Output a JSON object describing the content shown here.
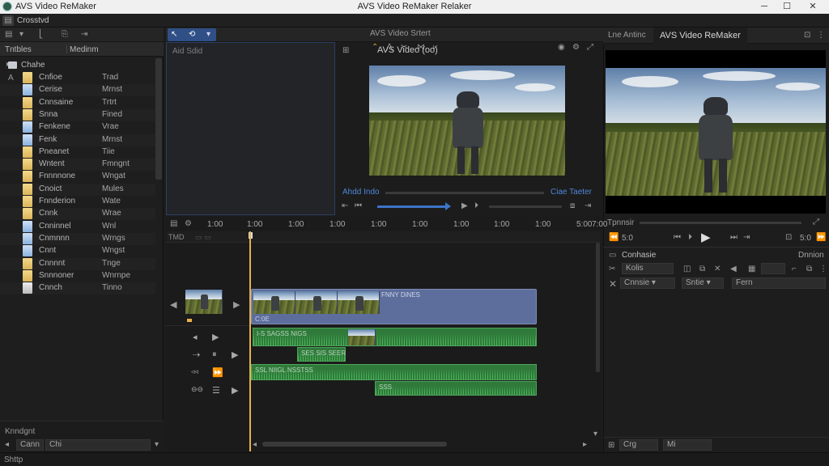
{
  "titlebar": {
    "app_name": "AVS Video ReMaker",
    "window_title": "AVS Video ReMaker Relaker",
    "minimize": "─",
    "maximize": "☐",
    "close": "✕"
  },
  "menu": {
    "project_name": "Crosstvd"
  },
  "mid_toolbar": {
    "title": "AVS Video Srtert"
  },
  "left_panel": {
    "header_left": "Tntbles",
    "header_right": "Medinm",
    "group_name": "Chahe",
    "files": [
      {
        "name": "Cnfioe",
        "type": "Trad",
        "icon": "folder"
      },
      {
        "name": "Cerise",
        "type": "Mrnst",
        "icon": "document"
      },
      {
        "name": "Cnnsaine",
        "type": "Trtrt",
        "icon": "folder"
      },
      {
        "name": "Snna",
        "type": "Fined",
        "icon": "folder"
      },
      {
        "name": "Fenkene",
        "type": "Vrae",
        "icon": "document"
      },
      {
        "name": "Fenk",
        "type": "Mrnst",
        "icon": "document"
      },
      {
        "name": "Pneanet",
        "type": "Tiie",
        "icon": "folder"
      },
      {
        "name": "Wntent",
        "type": "Fmngnt",
        "icon": "folder"
      },
      {
        "name": "Fnnnnone",
        "type": "Wngat",
        "icon": "folder"
      },
      {
        "name": "Cnoict",
        "type": "Mules",
        "icon": "folder"
      },
      {
        "name": "Fnnderion",
        "type": "Wate",
        "icon": "folder"
      },
      {
        "name": "Cnnk",
        "type": "Wrae",
        "icon": "folder"
      },
      {
        "name": "Cnninnel",
        "type": "Wnl",
        "icon": "document"
      },
      {
        "name": "Cnmnnn",
        "type": "Wrngs",
        "icon": "document"
      },
      {
        "name": "Cnnt",
        "type": "Wngst",
        "icon": "document"
      },
      {
        "name": "Cnnnnt",
        "type": "Tnge",
        "icon": "folder"
      },
      {
        "name": "Snnnoner",
        "type": "Wnrnpe",
        "icon": "folder"
      },
      {
        "name": "Cnnch",
        "type": "Tinno",
        "icon": "file"
      }
    ],
    "bottom_label": "Knndgnt",
    "search_value": "Cann",
    "search_value2": "Chi"
  },
  "mid_panel": {
    "label": "Aid Sdid"
  },
  "preview": {
    "title": "AVS Video (oo)",
    "left_label": "Ahdd Indo",
    "right_label": "Ciae Taeter"
  },
  "right_panel": {
    "tab1": "Lne Antinc",
    "tab2": "AVS Video ReMaker",
    "transport_label": "Tpnnsir",
    "time_left": "5:0",
    "time_right": "5:0",
    "section1": "Conhasie",
    "section1_right": "Dnnion",
    "field_a": "Kolis",
    "field_b": "Cnnsie",
    "field_c": "Sntie",
    "field_d": "Fern",
    "bottom_a": "Crg",
    "bottom_b": "Mi"
  },
  "timeline": {
    "ruler": [
      "1:00",
      "1:00",
      "1:00",
      "1:00",
      "1:00",
      "1:00",
      "1:00",
      "1:00",
      "1:00",
      "5:00",
      "7:00"
    ],
    "track_label": "TMD",
    "video_clip_label": "FNNY DiNES",
    "video_clip_sub": "C:0E",
    "audio_clip1_label": "I-S SAGSS NIGS",
    "audio_clip2_label": "SES SIS SEER",
    "audio_clip3_label": "SSL NIIGL NSSTSS",
    "audio_clip4_label": "SSS"
  },
  "statusbar": {
    "text": "Shttp"
  },
  "colors": {
    "accent": "#3d74c8",
    "playhead": "#e8b24a",
    "audio": "#2f7a3a",
    "video": "#5d6e9c"
  }
}
